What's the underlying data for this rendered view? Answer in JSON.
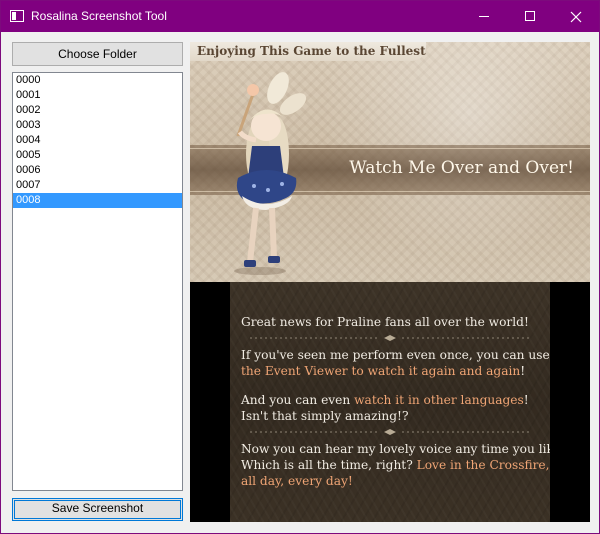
{
  "window": {
    "title": "Rosalina Screenshot Tool",
    "title_bar_color": "#800080",
    "controls": [
      "minimize-icon",
      "maximize-icon",
      "close-icon"
    ]
  },
  "left_panel": {
    "choose_folder_label": "Choose Folder",
    "save_screenshot_label": "Save Screenshot",
    "selection_color": "#3399ff",
    "files": [
      {
        "name": "0000",
        "selected": false
      },
      {
        "name": "0001",
        "selected": false
      },
      {
        "name": "0002",
        "selected": false
      },
      {
        "name": "0003",
        "selected": false
      },
      {
        "name": "0004",
        "selected": false
      },
      {
        "name": "0005",
        "selected": false
      },
      {
        "name": "0006",
        "selected": false
      },
      {
        "name": "0007",
        "selected": false
      },
      {
        "name": "0008",
        "selected": true
      }
    ]
  },
  "screenshot": {
    "top_screen": {
      "header": "Enjoying This Game to the Fullest",
      "banner": "Watch Me Over and Over!"
    },
    "bottom_screen": {
      "highlight_color": "#f0a575",
      "paragraphs": [
        {
          "lines": [
            [
              {
                "text": "Great news for Praline fans all over the world!",
                "hl": false
              }
            ]
          ]
        },
        {
          "lines": [
            [
              {
                "text": "If you've seen me perform even once, you can use",
                "hl": false
              }
            ],
            [
              {
                "text": "the Event Viewer to watch it again and again",
                "hl": true
              },
              {
                "text": "!",
                "hl": false
              }
            ]
          ]
        },
        {
          "lines": [
            [
              {
                "text": "And you can even ",
                "hl": false
              },
              {
                "text": "watch it in other languages",
                "hl": true
              },
              {
                "text": "!",
                "hl": false
              }
            ],
            [
              {
                "text": "Isn't that simply amazing!?",
                "hl": false
              }
            ]
          ]
        },
        {
          "lines": [
            [
              {
                "text": "Now you can hear my lovely voice any time you like!",
                "hl": false
              }
            ],
            [
              {
                "text": "Which is all the time, right? ",
                "hl": false
              },
              {
                "text": "Love in the Crossfire,",
                "hl": true
              }
            ],
            [
              {
                "text": "all day, every day!",
                "hl": true
              }
            ]
          ]
        }
      ]
    }
  }
}
